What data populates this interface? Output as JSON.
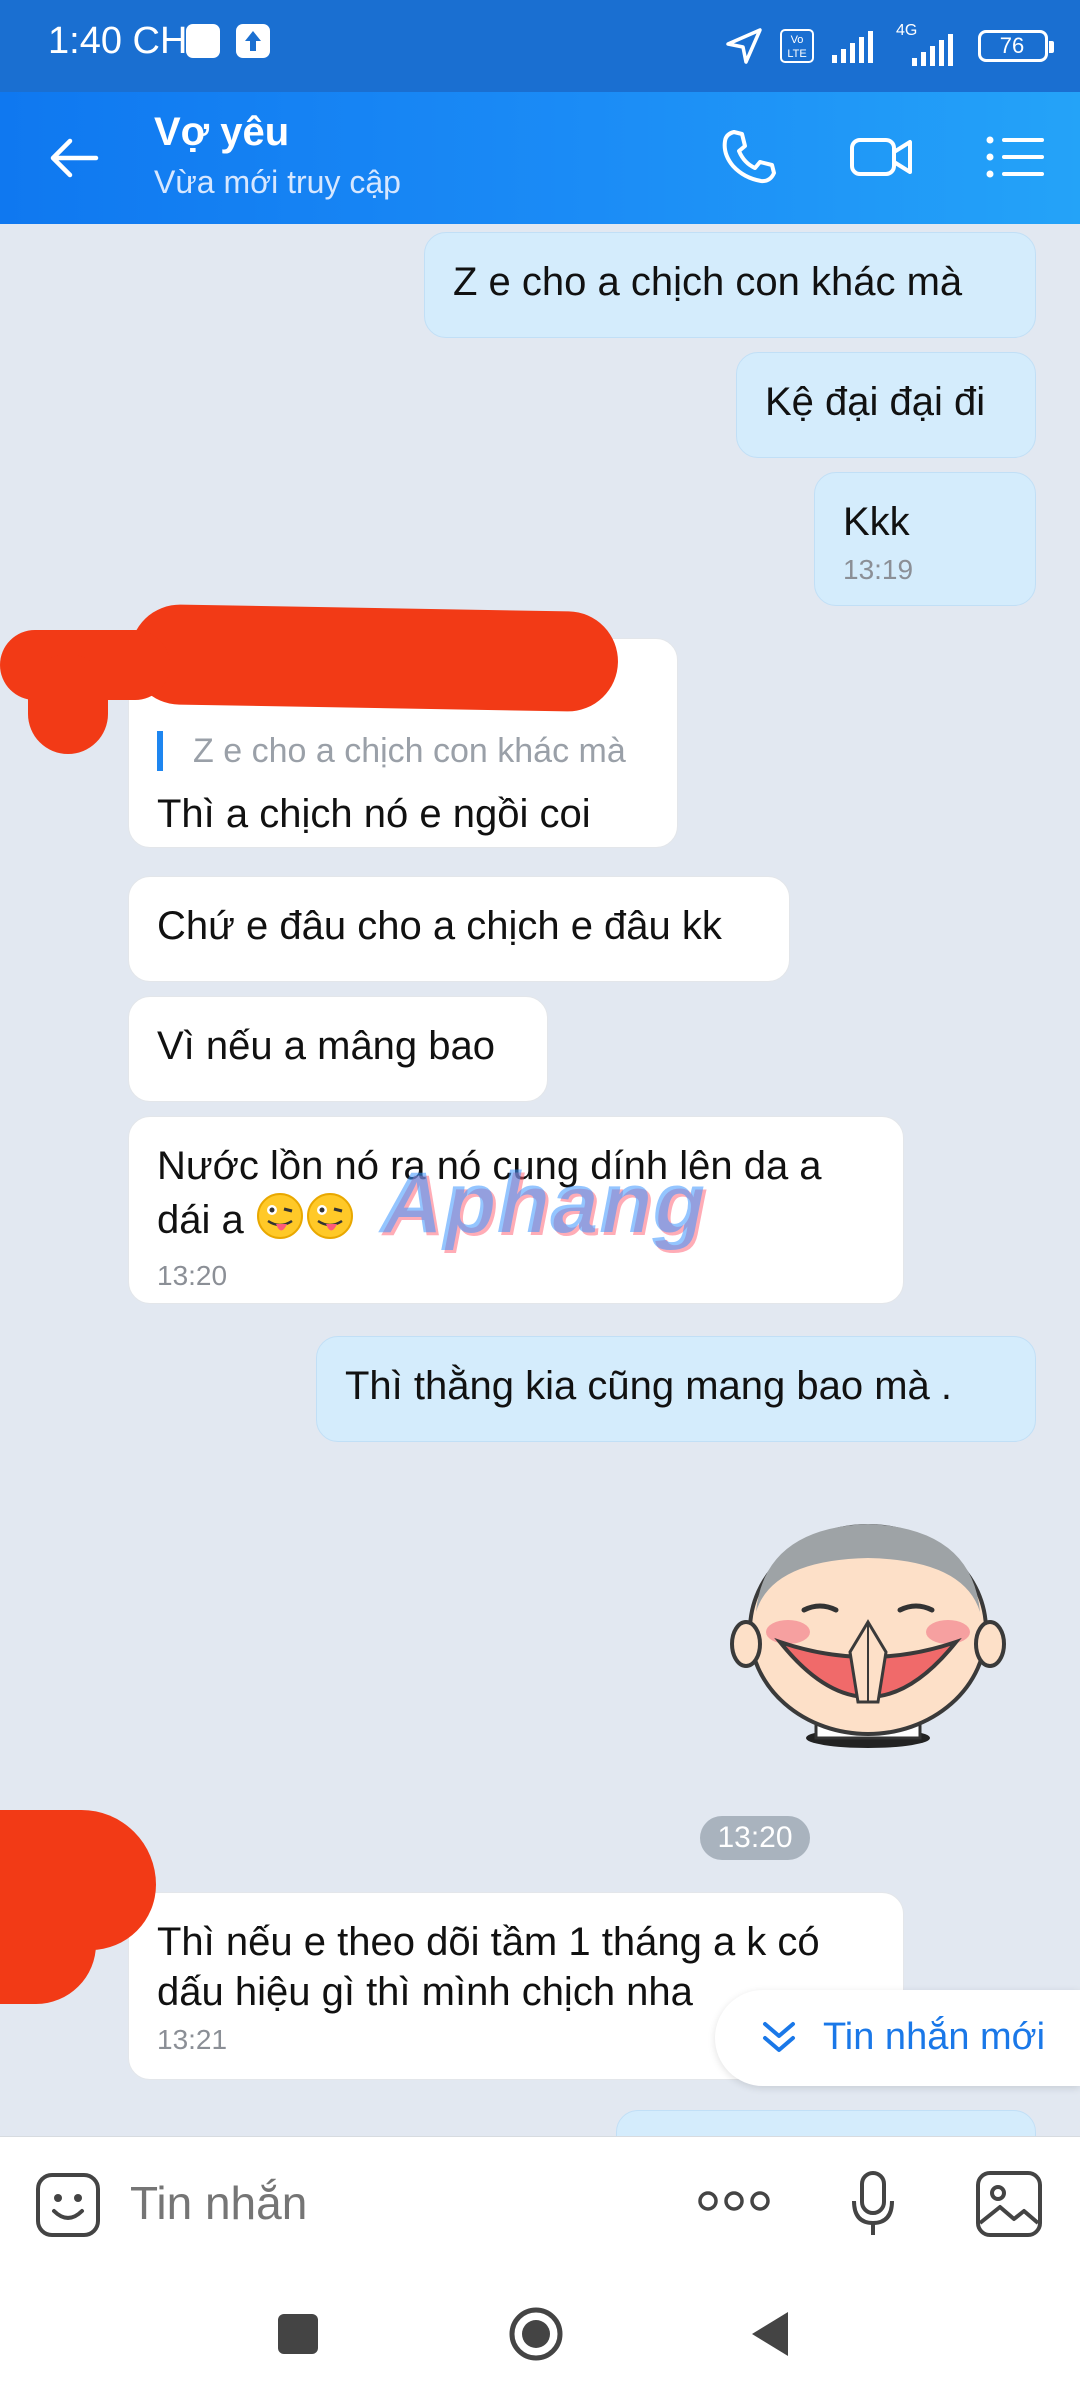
{
  "status_bar": {
    "time": "1:40 CH",
    "network": "4G",
    "volte_label": "Vo LTE",
    "battery": "76"
  },
  "header": {
    "contact_name": "Vợ yêu",
    "contact_status": "Vừa mới truy cập"
  },
  "messages": [
    {
      "id": 1,
      "side": "me",
      "text": "Z e cho a chịch con khác mà",
      "time": ""
    },
    {
      "id": 2,
      "side": "me",
      "text": "Kệ đại đại đi",
      "time": ""
    },
    {
      "id": 3,
      "side": "me",
      "text": "Kkk",
      "time": "13:19"
    },
    {
      "id": 4,
      "side": "them",
      "quote": "Z e cho a chịch con khác mà",
      "text": "Thì a chịch nó e ngồi coi",
      "time": ""
    },
    {
      "id": 5,
      "side": "them",
      "text": "Chứ e đâu cho a chịch e đâu kk",
      "time": ""
    },
    {
      "id": 6,
      "side": "them",
      "text": "Vì nếu a mâng bao",
      "time": ""
    },
    {
      "id": 7,
      "side": "them",
      "text": "Nước lồn nó ra nó cung dính lên da a dái a",
      "time": "13:20"
    },
    {
      "id": 8,
      "side": "me",
      "text": "Thì thằng kia cũng mang bao mà .",
      "time": ""
    },
    {
      "id": 9,
      "side": "them",
      "text": "Thì nếu e theo dõi tầm 1 tháng a k có dấu hiệu gì thì mình chịch nha",
      "time": "13:21"
    }
  ],
  "sticker_time": "13:20",
  "watermark": "Aphang",
  "new_messages_button": "Tin nhắn mới",
  "composer": {
    "placeholder": "Tin nhắn"
  },
  "colors": {
    "header": "#1a78ee",
    "my_bubble": "#d4ecfc",
    "their_bubble": "#ffffff",
    "accent": "#1a78e8",
    "background": "#e2e8f1"
  },
  "icons": {
    "back": "back-arrow-icon",
    "call": "phone-icon",
    "video": "video-camera-icon",
    "menu": "list-menu-icon",
    "emoji": "sticker-face-icon",
    "more": "more-dots-icon",
    "mic": "microphone-icon",
    "image": "image-icon",
    "new_msg": "double-chevron-down-icon"
  }
}
